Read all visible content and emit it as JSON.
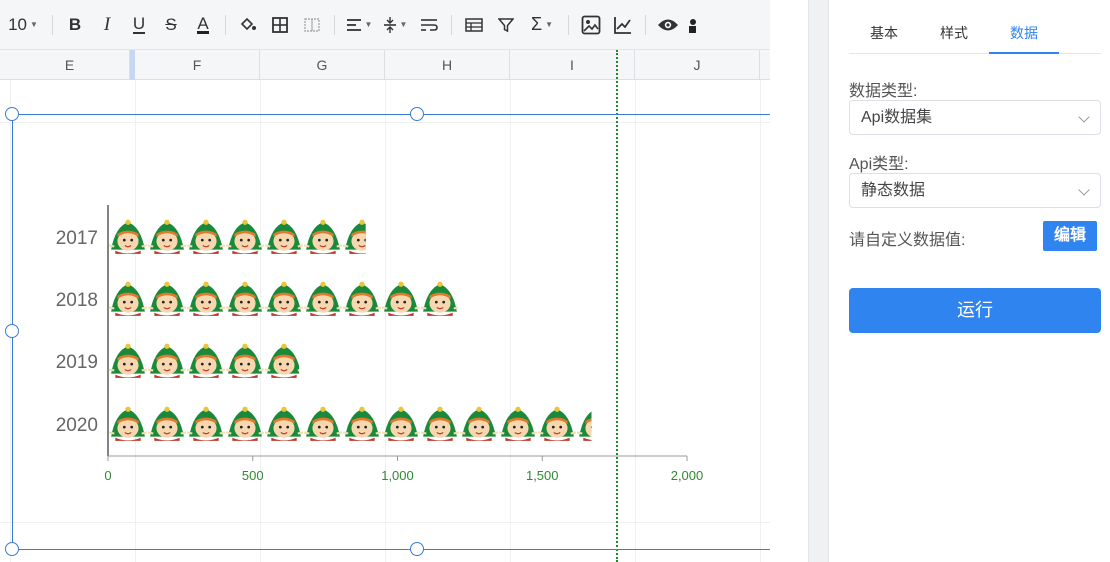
{
  "toolbar": {
    "font_size": "10",
    "bold": "B",
    "italic": "I",
    "underline": "U",
    "strike": "S",
    "font_color": "A",
    "icons": [
      "fill-color-icon",
      "borders-icon",
      "merge-cells-icon",
      "align-left-icon",
      "vertical-align-icon",
      "wrap-text-icon",
      "table-icon",
      "filter-icon",
      "sum-icon",
      "image-icon",
      "chart-icon",
      "preview-icon"
    ]
  },
  "columns": [
    "E",
    "F",
    "G",
    "H",
    "I",
    "J"
  ],
  "tabs": [
    {
      "label": "基本"
    },
    {
      "label": "样式"
    },
    {
      "label": "数据"
    }
  ],
  "active_tab": "数据",
  "form": {
    "data_type_label": "数据类型:",
    "data_type_value": "Api数据集",
    "api_type_label": "Api类型:",
    "api_type_value": "静态数据",
    "custom_label": "请自定义数据值:",
    "edit_button": "编辑",
    "run_button": "运行"
  },
  "colors": {
    "accent": "#2f84f0",
    "tick_green": "#2e8b2e",
    "elf_green": "#1a8a3a"
  },
  "chart_data": {
    "type": "bar",
    "orientation": "horizontal",
    "style": "pictorial",
    "symbol": "elf-icon",
    "categories": [
      "2017",
      "2018",
      "2019",
      "2020"
    ],
    "values": [
      890,
      1210,
      660,
      1670
    ],
    "xlim": [
      0,
      2000
    ],
    "xticks": [
      "0",
      "500",
      "1,000",
      "1,500",
      "2,000"
    ],
    "xtick_values": [
      0,
      500,
      1000,
      1500,
      2000
    ]
  }
}
